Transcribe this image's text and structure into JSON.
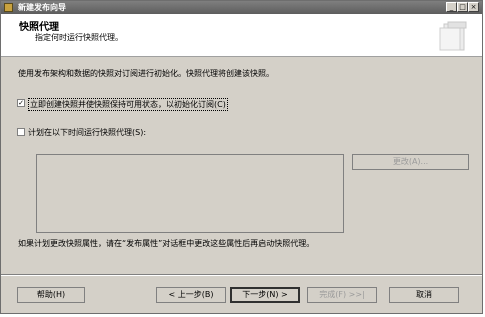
{
  "window": {
    "title": "新建发布向导",
    "minimize_glyph": "_",
    "maximize_glyph": "□",
    "close_glyph": "×"
  },
  "header": {
    "title": "快照代理",
    "subtitle": "指定何时运行快照代理。"
  },
  "body": {
    "description": "使用发布架构和数据的快照对订阅进行初始化。快照代理将创建该快照。",
    "option_immediate": {
      "label": "立即创建快照并使快照保持可用状态，以初始化订阅(C)",
      "checked": true,
      "check_glyph": "✓"
    },
    "option_schedule": {
      "label": "计划在以下时间运行快照代理(S):",
      "checked": false
    },
    "change_button": "更改(A)...",
    "note": "如果计划更改快照属性，请在“发布属性”对话框中更改这些属性后再启动快照代理。"
  },
  "footer": {
    "help": "帮助(H)",
    "back": "< 上一步(B)",
    "next": "下一步(N) >",
    "finish": "完成(F) >>|",
    "cancel": "取消"
  },
  "colors": {
    "dialog_bg": "#d4d0c8",
    "titlebar": "#6a6a6a",
    "disabled_text": "#9a9a9a"
  }
}
